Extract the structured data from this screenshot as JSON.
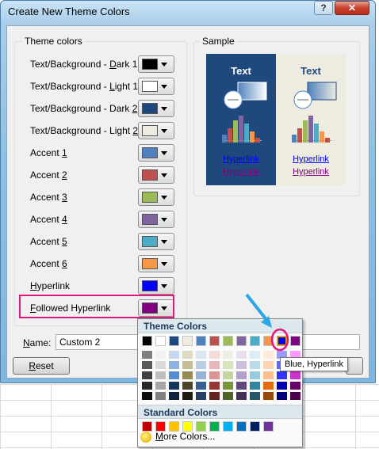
{
  "window": {
    "title": "Create New Theme Colors",
    "help_label": "?",
    "close_label": "✕"
  },
  "theme_colors": {
    "label": "Theme colors",
    "rows": [
      {
        "pre": "Text/Background - ",
        "key": "D",
        "post": "ark 1",
        "color": "#000000"
      },
      {
        "pre": "Text/Background - ",
        "key": "L",
        "post": "ight 1",
        "color": "#ffffff"
      },
      {
        "pre": "Text/Background - Dark ",
        "key": "2",
        "post": "",
        "color": "#1f497d"
      },
      {
        "pre": "Text/Background - Light ",
        "key": "2",
        "post": "",
        "color": "#eeece1"
      },
      {
        "pre": "Accent ",
        "key": "1",
        "post": "",
        "color": "#4f81bd"
      },
      {
        "pre": "Accent ",
        "key": "2",
        "post": "",
        "color": "#c0504d"
      },
      {
        "pre": "Accent ",
        "key": "3",
        "post": "",
        "color": "#9bbb59"
      },
      {
        "pre": "Accent ",
        "key": "4",
        "post": "",
        "color": "#8064a2"
      },
      {
        "pre": "Accent ",
        "key": "5",
        "post": "",
        "color": "#4bacc6"
      },
      {
        "pre": "Accent ",
        "key": "6",
        "post": "",
        "color": "#f79646"
      },
      {
        "pre": "",
        "key": "H",
        "post": "yperlink",
        "color": "#0000ff"
      },
      {
        "pre": "",
        "key": "F",
        "post": "ollowed Hyperlink",
        "color": "#800080"
      }
    ]
  },
  "sample": {
    "label": "Sample",
    "dark_text": "Text",
    "light_text": "Text",
    "hyperlink": "Hyperlink",
    "followed": "Hyperlink",
    "bar_colors": [
      "#4f81bd",
      "#c0504d",
      "#9bbb59",
      "#8064a2",
      "#4bacc6",
      "#f79646",
      "#c0504d"
    ]
  },
  "name_field": {
    "label_pre": "",
    "label_key": "N",
    "label_post": "ame:",
    "value": "Custom 2"
  },
  "reset_button": {
    "pre": "",
    "key": "R",
    "post": "eset"
  },
  "dropdown": {
    "theme_header": "Theme Colors",
    "standard_header": "Standard Colors",
    "theme_row": [
      "#000000",
      "#ffffff",
      "#1f497d",
      "#eeece1",
      "#4f81bd",
      "#c0504d",
      "#9bbb59",
      "#8064a2",
      "#4bacc6",
      "#f79646",
      "#0000ff",
      "#800080"
    ],
    "shades": [
      [
        "#7f7f7f",
        "#595959",
        "#404040",
        "#262626",
        "#0d0d0d"
      ],
      [
        "#f2f2f2",
        "#d9d9d9",
        "#bfbfbf",
        "#a6a6a6",
        "#808080"
      ],
      [
        "#c6d9f1",
        "#8db3e2",
        "#548dd4",
        "#17365d",
        "#0f243e"
      ],
      [
        "#ddd9c3",
        "#c4bd97",
        "#948a54",
        "#4a452a",
        "#1e1c11"
      ],
      [
        "#dce6f2",
        "#b9cde5",
        "#95b3d7",
        "#366092",
        "#244062"
      ],
      [
        "#f2dcdb",
        "#e6b9b8",
        "#d99694",
        "#953735",
        "#632523"
      ],
      [
        "#ebf1de",
        "#d7e4bd",
        "#c3d69b",
        "#77933c",
        "#4f6228"
      ],
      [
        "#e6e0ec",
        "#ccc1da",
        "#b3a2c7",
        "#604a7b",
        "#403152"
      ],
      [
        "#dbeef4",
        "#b7dee8",
        "#93cddd",
        "#31859c",
        "#215968"
      ],
      [
        "#fdeada",
        "#fcd5b5",
        "#fac090",
        "#e46c0a",
        "#984807"
      ],
      [
        "#9999ff",
        "#6666ff",
        "#3333ff",
        "#0000b3",
        "#000080"
      ],
      [
        "#ff99ff",
        "#ff66ff",
        "#cc33cc",
        "#660066",
        "#4d004d"
      ]
    ],
    "standard_row": [
      "#c00000",
      "#ff0000",
      "#ffc000",
      "#ffff00",
      "#92d050",
      "#00b050",
      "#00b0f0",
      "#0070c0",
      "#002060",
      "#7030a0"
    ],
    "more_colors": "More Colors...",
    "more_key": "M",
    "tooltip": "Blue, Hyperlink"
  },
  "annotation": {
    "highlight_color": "#e3167a",
    "arrow_color": "#2aa7e8"
  }
}
